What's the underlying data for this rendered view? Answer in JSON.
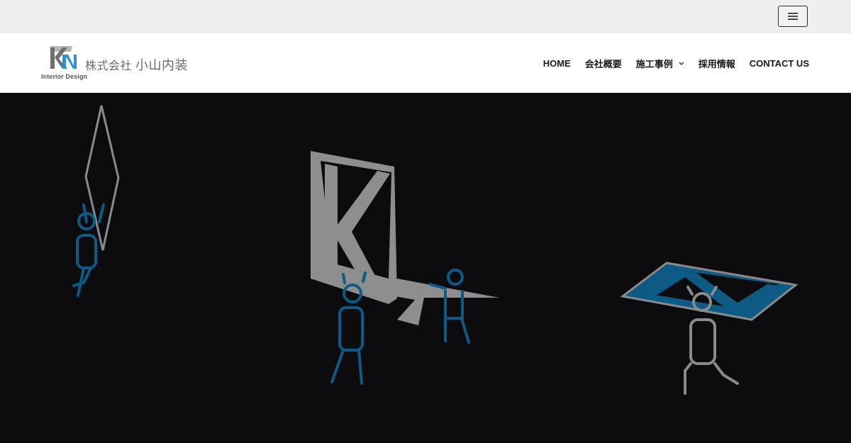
{
  "header": {
    "logo_tagline": "Interior Design",
    "company_prefix": "株式会社",
    "company_name": "小山内装",
    "menu_toggle_icon": "hamburger-menu-icon"
  },
  "nav": {
    "items": [
      {
        "label": "HOME",
        "has_dropdown": false
      },
      {
        "label": "会社概要",
        "has_dropdown": false
      },
      {
        "label": "施工事例",
        "has_dropdown": true,
        "icon": "chevron-down-icon"
      },
      {
        "label": "採用情報",
        "has_dropdown": false
      },
      {
        "label": "CONTACT US",
        "has_dropdown": false
      }
    ]
  },
  "hero": {
    "colors": {
      "background": "#0c0c0e",
      "blue": "#0d5a85",
      "gray": "#8a8a8a"
    }
  }
}
